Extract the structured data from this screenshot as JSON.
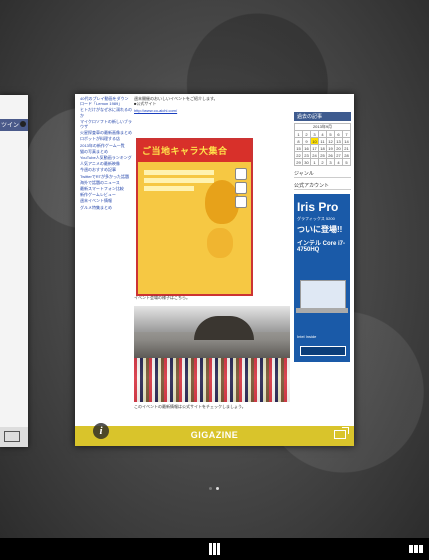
{
  "left_card": {
    "band_text": "ツイン"
  },
  "card": {
    "title": "GIGAZINE",
    "left_links": [
      "40代のプレイ動画をダウンロード「Lemon 1989」",
      "ヒトだけがなぜ水に溺れるのか",
      "マイクロソフトの新しいブラウザ",
      "火星探査車の最新画像まとめ",
      "ロボットが料理する店",
      "2013年の新作ゲーム一覧",
      "猫の写真まとめ",
      "YouTube人気動画ランキング",
      "人気アニメの最新映像",
      "今週のおすすめ記事",
      "TwitterでRTが多かった話題",
      "海外で話題のニュース",
      "最新スマートフォン比較",
      "新作ゲームレビュー",
      "週末イベント情報",
      "グルメ特集まとめ"
    ],
    "intro": "週末開催のおいしいイベントをご紹介します。",
    "site_label": "■公式サイト",
    "url": "http://www.co-aichi.com/",
    "caption1": "イベント会場の様子はこちら。",
    "caption2": "このイベントの最新情報は公式サイトをチェックしましょう。",
    "poster": {
      "banner": "ご当地キャラ大集合"
    },
    "right": {
      "archive_header": "過去の記事",
      "month": "2013年9月",
      "calendar": [
        [
          "1",
          "2",
          "3",
          "4",
          "5",
          "6",
          "7"
        ],
        [
          "8",
          "9",
          "10",
          "11",
          "12",
          "13",
          "14"
        ],
        [
          "15",
          "16",
          "17",
          "18",
          "19",
          "20",
          "21"
        ],
        [
          "22",
          "23",
          "24",
          "25",
          "26",
          "27",
          "28"
        ],
        [
          "29",
          "30",
          "1",
          "2",
          "3",
          "4",
          "5"
        ]
      ],
      "highlight_day": "10",
      "genre": "ジャンル",
      "official": "公式アカウント",
      "ad": {
        "brand": "Iris Pro",
        "line1": "グラフィックス 5200",
        "line2": "ついに登場!!",
        "line3": "インテル Core i7-4750HQ",
        "bottom": "Intel Inside",
        "button": "詳しくはこちら"
      }
    }
  },
  "page_indicator": {
    "count": 2,
    "active": 1
  },
  "bottom_bar": {
    "left_icon": "grid-icon",
    "right_icon": "tabs-icon"
  }
}
